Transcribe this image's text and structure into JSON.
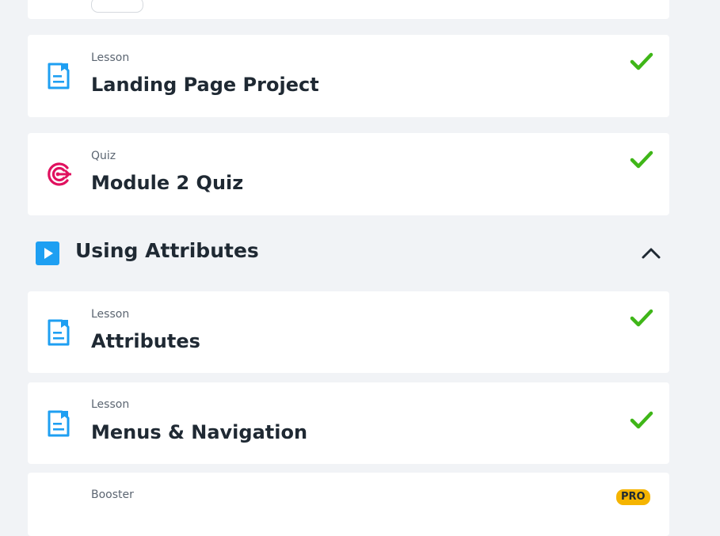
{
  "items": [
    {
      "kind": "Lesson",
      "title": "Landing Page Project",
      "icon": "lesson-document-icon",
      "completed": true
    },
    {
      "kind": "Quiz",
      "title": "Module 2 Quiz",
      "icon": "quiz-target-icon",
      "completed": true
    }
  ],
  "section": {
    "title": "Using Attributes",
    "icon": "play-icon",
    "toggle_icon": "chevron-up-icon",
    "expanded": true
  },
  "section_items": [
    {
      "kind": "Lesson",
      "title": "Attributes",
      "icon": "lesson-document-icon",
      "completed": true
    },
    {
      "kind": "Lesson",
      "title": "Menus & Navigation",
      "icon": "lesson-document-icon",
      "completed": true
    },
    {
      "kind": "Booster",
      "badge": "PRO"
    }
  ],
  "colors": {
    "page_background": "#f1f3f6",
    "card_background": "#ffffff",
    "lesson_icon": "#1e9ff2",
    "quiz_icon": "#e0115f",
    "check": "#3fb618",
    "pro_badge": "#f5b400"
  }
}
